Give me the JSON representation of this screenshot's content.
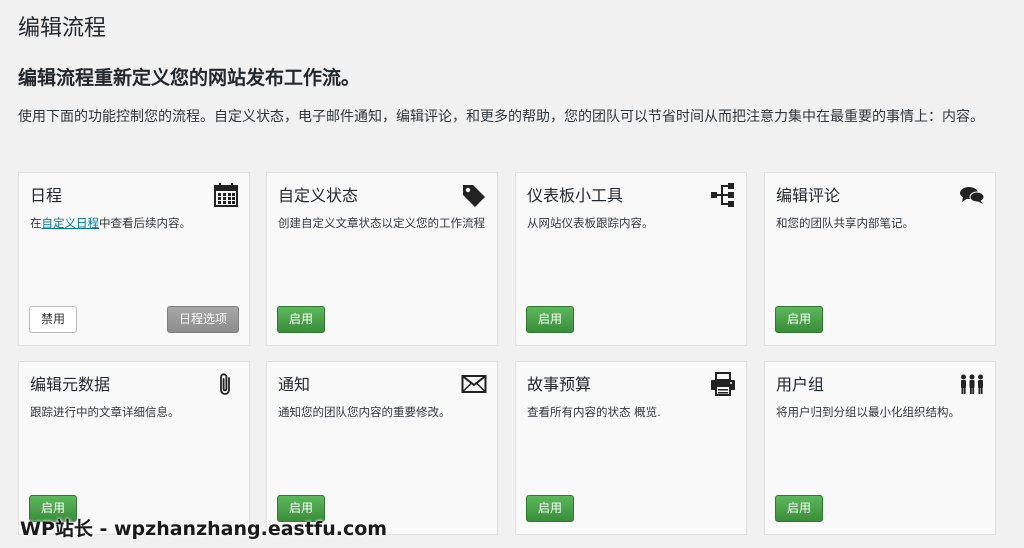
{
  "page": {
    "title": "编辑流程",
    "subtitle": "编辑流程重新定义您的网站发布工作流。",
    "intro": "使用下面的功能控制您的流程。自定义状态，电子邮件通知，编辑评论，和更多的帮助，您的团队可以节省时间从而把注意力集中在最重要的事情上：内容。"
  },
  "colors": {
    "background": "#f1f1f1",
    "card_background": "#f9f9f9",
    "enable_button": "#4cae4c",
    "options_button": "#999999",
    "link": "#0073aa"
  },
  "cards": [
    {
      "title": "日程",
      "icon": "calendar-icon",
      "desc_prefix": "在",
      "desc_link": "自定义日程",
      "desc_suffix": "中查看后续内容。",
      "disable_label": "禁用",
      "options_label": "日程选项"
    },
    {
      "title": "自定义状态",
      "icon": "tag-icon",
      "desc": "创建自定义文章状态以定义您的工作流程",
      "enable_label": "启用"
    },
    {
      "title": "仪表板小工具",
      "icon": "sitemap-icon",
      "desc": "从网站仪表板跟踪内容。",
      "enable_label": "启用"
    },
    {
      "title": "编辑评论",
      "icon": "comments-icon",
      "desc": "和您的团队共享内部笔记。",
      "enable_label": "启用"
    },
    {
      "title": "编辑元数据",
      "icon": "paperclip-icon",
      "desc": "跟踪进行中的文章详细信息。",
      "enable_label": "启用"
    },
    {
      "title": "通知",
      "icon": "envelope-icon",
      "desc": "通知您的团队您内容的重要修改。",
      "enable_label": "启用"
    },
    {
      "title": "故事预算",
      "icon": "printer-icon",
      "desc": "查看所有内容的状态 概览.",
      "enable_label": "启用"
    },
    {
      "title": "用户组",
      "icon": "users-icon",
      "desc": "将用户归到分组以最小化组织结构。",
      "enable_label": "启用"
    }
  ],
  "watermark": "WP站长 - wpzhanzhang.eastfu.com"
}
